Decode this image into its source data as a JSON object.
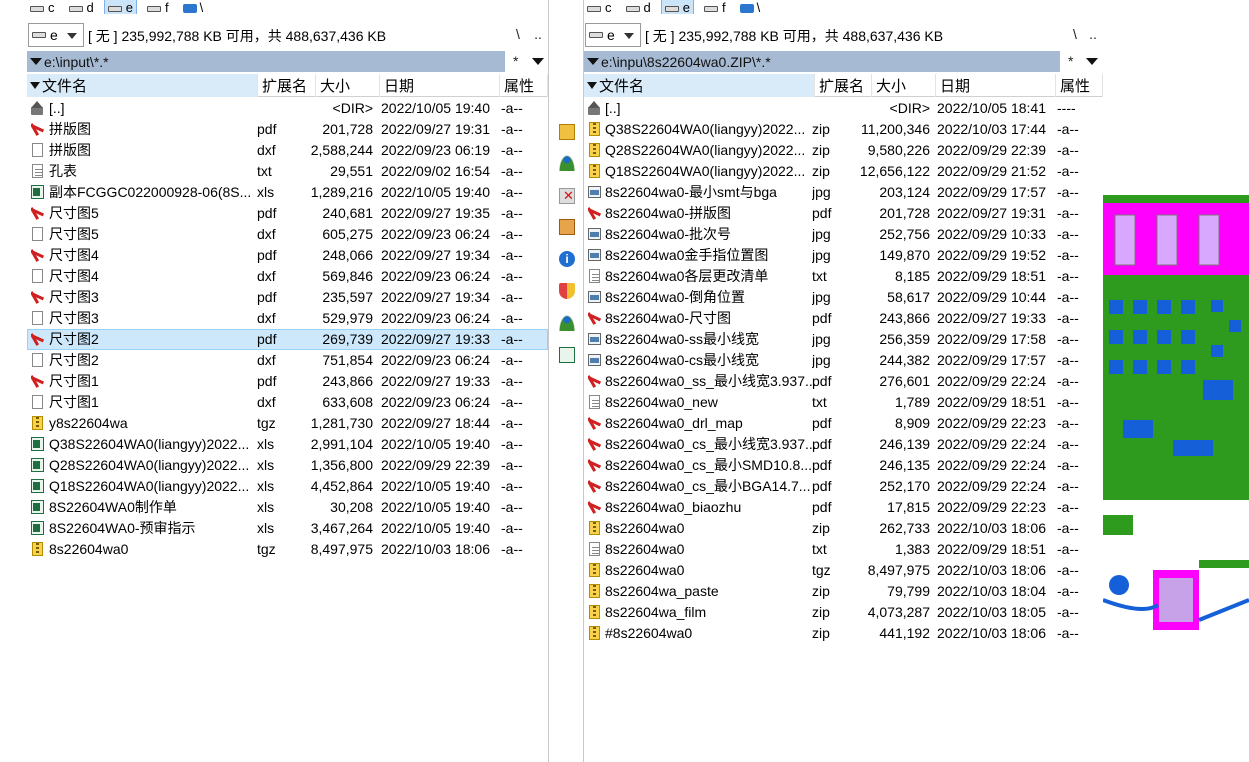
{
  "left": {
    "drives": [
      {
        "label": "c",
        "selected": false,
        "icon": "hard-drive-icon"
      },
      {
        "label": "d",
        "selected": false,
        "icon": "hard-drive-icon"
      },
      {
        "label": "e",
        "selected": true,
        "icon": "hard-drive-icon"
      },
      {
        "label": "f",
        "selected": false,
        "icon": "hard-drive-icon"
      },
      {
        "label": "\\",
        "selected": false,
        "icon": "network-drive-icon"
      }
    ],
    "drive_combo": "e",
    "free_info": "[ 无 ]  235,992,788 KB 可用，共 488,637,436 KB",
    "root_btn": "\\",
    "up_btn": "..",
    "path": "e:\\input\\*.*",
    "fav_btn": "*",
    "columns": {
      "name": "文件名",
      "ext": "扩展名",
      "size": "大小",
      "date": "日期",
      "attr": "属性"
    },
    "files": [
      {
        "icon": "up-folder-icon",
        "name": "[..]",
        "ext": "",
        "size": "<DIR>",
        "date": "2022/10/05 19:40",
        "attr": "-a--"
      },
      {
        "icon": "pdf-icon",
        "name": "拼版图",
        "ext": "pdf",
        "size": "201,728",
        "date": "2022/09/27 19:31",
        "attr": "-a--"
      },
      {
        "icon": "file-icon",
        "name": "拼版图",
        "ext": "dxf",
        "size": "2,588,244",
        "date": "2022/09/23 06:19",
        "attr": "-a--"
      },
      {
        "icon": "text-file-icon",
        "name": "孔表",
        "ext": "txt",
        "size": "29,551",
        "date": "2022/09/02 16:54",
        "attr": "-a--"
      },
      {
        "icon": "excel-icon",
        "name": "副本FCGGC022000928-06(8S...",
        "ext": "xls",
        "size": "1,289,216",
        "date": "2022/10/05 19:40",
        "attr": "-a--"
      },
      {
        "icon": "pdf-icon",
        "name": "尺寸图5",
        "ext": "pdf",
        "size": "240,681",
        "date": "2022/09/27 19:35",
        "attr": "-a--"
      },
      {
        "icon": "file-icon",
        "name": "尺寸图5",
        "ext": "dxf",
        "size": "605,275",
        "date": "2022/09/23 06:24",
        "attr": "-a--"
      },
      {
        "icon": "pdf-icon",
        "name": "尺寸图4",
        "ext": "pdf",
        "size": "248,066",
        "date": "2022/09/27 19:34",
        "attr": "-a--"
      },
      {
        "icon": "file-icon",
        "name": "尺寸图4",
        "ext": "dxf",
        "size": "569,846",
        "date": "2022/09/23 06:24",
        "attr": "-a--"
      },
      {
        "icon": "pdf-icon",
        "name": "尺寸图3",
        "ext": "pdf",
        "size": "235,597",
        "date": "2022/09/27 19:34",
        "attr": "-a--"
      },
      {
        "icon": "file-icon",
        "name": "尺寸图3",
        "ext": "dxf",
        "size": "529,979",
        "date": "2022/09/23 06:24",
        "attr": "-a--"
      },
      {
        "icon": "pdf-icon",
        "name": "尺寸图2",
        "ext": "pdf",
        "size": "269,739",
        "date": "2022/09/27 19:33",
        "attr": "-a--",
        "selected": true
      },
      {
        "icon": "file-icon",
        "name": "尺寸图2",
        "ext": "dxf",
        "size": "751,854",
        "date": "2022/09/23 06:24",
        "attr": "-a--"
      },
      {
        "icon": "pdf-icon",
        "name": "尺寸图1",
        "ext": "pdf",
        "size": "243,866",
        "date": "2022/09/27 19:33",
        "attr": "-a--"
      },
      {
        "icon": "file-icon",
        "name": "尺寸图1",
        "ext": "dxf",
        "size": "633,608",
        "date": "2022/09/23 06:24",
        "attr": "-a--"
      },
      {
        "icon": "archive-icon",
        "name": "y8s22604wa",
        "ext": "tgz",
        "size": "1,281,730",
        "date": "2022/09/27 18:44",
        "attr": "-a--"
      },
      {
        "icon": "excel-icon",
        "name": "Q38S22604WA0(liangyy)2022...",
        "ext": "xls",
        "size": "2,991,104",
        "date": "2022/10/05 19:40",
        "attr": "-a--"
      },
      {
        "icon": "excel-icon",
        "name": "Q28S22604WA0(liangyy)2022...",
        "ext": "xls",
        "size": "1,356,800",
        "date": "2022/09/29 22:39",
        "attr": "-a--"
      },
      {
        "icon": "excel-icon",
        "name": "Q18S22604WA0(liangyy)2022...",
        "ext": "xls",
        "size": "4,452,864",
        "date": "2022/10/05 19:40",
        "attr": "-a--"
      },
      {
        "icon": "excel-icon",
        "name": "8S22604WA0制作单",
        "ext": "xls",
        "size": "30,208",
        "date": "2022/10/05 19:40",
        "attr": "-a--"
      },
      {
        "icon": "excel-icon",
        "name": "8S22604WA0-预审指示",
        "ext": "xls",
        "size": "3,467,264",
        "date": "2022/10/05 19:40",
        "attr": "-a--"
      },
      {
        "icon": "archive-icon",
        "name": "8s22604wa0",
        "ext": "tgz",
        "size": "8,497,975",
        "date": "2022/10/03 18:06",
        "attr": "-a--"
      }
    ]
  },
  "right": {
    "drives": [
      {
        "label": "c",
        "selected": false,
        "icon": "hard-drive-icon"
      },
      {
        "label": "d",
        "selected": false,
        "icon": "hard-drive-icon"
      },
      {
        "label": "e",
        "selected": true,
        "icon": "hard-drive-icon"
      },
      {
        "label": "f",
        "selected": false,
        "icon": "hard-drive-icon"
      },
      {
        "label": "\\",
        "selected": false,
        "icon": "network-drive-icon"
      }
    ],
    "drive_combo": "e",
    "free_info": "[ 无 ]  235,992,788 KB 可用，共 488,637,436 KB",
    "root_btn": "\\",
    "up_btn": "..",
    "path": "e:\\inpu\\8s22604wa0.ZIP\\*.*",
    "fav_btn": "*",
    "columns": {
      "name": "文件名",
      "ext": "扩展名",
      "size": "大小",
      "date": "日期",
      "attr": "属性"
    },
    "files": [
      {
        "icon": "up-folder-icon",
        "name": "[..]",
        "ext": "",
        "size": "<DIR>",
        "date": "2022/10/05 18:41",
        "attr": "----"
      },
      {
        "icon": "archive-icon",
        "name": "Q38S22604WA0(liangyy)2022...",
        "ext": "zip",
        "size": "11,200,346",
        "date": "2022/10/03 17:44",
        "attr": "-a--"
      },
      {
        "icon": "archive-icon",
        "name": "Q28S22604WA0(liangyy)2022...",
        "ext": "zip",
        "size": "9,580,226",
        "date": "2022/09/29 22:39",
        "attr": "-a--"
      },
      {
        "icon": "archive-icon",
        "name": "Q18S22604WA0(liangyy)2022...",
        "ext": "zip",
        "size": "12,656,122",
        "date": "2022/09/29 21:52",
        "attr": "-a--"
      },
      {
        "icon": "image-icon",
        "name": "8s22604wa0-最小smt与bga",
        "ext": "jpg",
        "size": "203,124",
        "date": "2022/09/29 17:57",
        "attr": "-a--"
      },
      {
        "icon": "pdf-icon",
        "name": "8s22604wa0-拼版图",
        "ext": "pdf",
        "size": "201,728",
        "date": "2022/09/27 19:31",
        "attr": "-a--"
      },
      {
        "icon": "image-icon",
        "name": "8s22604wa0-批次号",
        "ext": "jpg",
        "size": "252,756",
        "date": "2022/09/29 10:33",
        "attr": "-a--"
      },
      {
        "icon": "image-icon",
        "name": "8s22604wa0金手指位置图",
        "ext": "jpg",
        "size": "149,870",
        "date": "2022/09/29 19:52",
        "attr": "-a--"
      },
      {
        "icon": "text-file-icon",
        "name": "8s22604wa0各层更改清单",
        "ext": "txt",
        "size": "8,185",
        "date": "2022/09/29 18:51",
        "attr": "-a--"
      },
      {
        "icon": "image-icon",
        "name": "8s22604wa0-倒角位置",
        "ext": "jpg",
        "size": "58,617",
        "date": "2022/09/29 10:44",
        "attr": "-a--"
      },
      {
        "icon": "pdf-icon",
        "name": "8s22604wa0-尺寸图",
        "ext": "pdf",
        "size": "243,866",
        "date": "2022/09/27 19:33",
        "attr": "-a--"
      },
      {
        "icon": "image-icon",
        "name": "8s22604wa0-ss最小线宽",
        "ext": "jpg",
        "size": "256,359",
        "date": "2022/09/29 17:58",
        "attr": "-a--"
      },
      {
        "icon": "image-icon",
        "name": "8s22604wa0-cs最小线宽",
        "ext": "jpg",
        "size": "244,382",
        "date": "2022/09/29 17:57",
        "attr": "-a--"
      },
      {
        "icon": "pdf-icon",
        "name": "8s22604wa0_ss_最小线宽3.937...",
        "ext": "pdf",
        "size": "276,601",
        "date": "2022/09/29 22:24",
        "attr": "-a--"
      },
      {
        "icon": "text-file-icon",
        "name": "8s22604wa0_new",
        "ext": "txt",
        "size": "1,789",
        "date": "2022/09/29 18:51",
        "attr": "-a--"
      },
      {
        "icon": "pdf-icon",
        "name": "8s22604wa0_drl_map",
        "ext": "pdf",
        "size": "8,909",
        "date": "2022/09/29 22:23",
        "attr": "-a--"
      },
      {
        "icon": "pdf-icon",
        "name": "8s22604wa0_cs_最小线宽3.937...",
        "ext": "pdf",
        "size": "246,139",
        "date": "2022/09/29 22:24",
        "attr": "-a--"
      },
      {
        "icon": "pdf-icon",
        "name": "8s22604wa0_cs_最小SMD10.8...",
        "ext": "pdf",
        "size": "246,135",
        "date": "2022/09/29 22:24",
        "attr": "-a--"
      },
      {
        "icon": "pdf-icon",
        "name": "8s22604wa0_cs_最小BGA14.7...",
        "ext": "pdf",
        "size": "252,170",
        "date": "2022/09/29 22:24",
        "attr": "-a--"
      },
      {
        "icon": "pdf-icon",
        "name": "8s22604wa0_biaozhu",
        "ext": "pdf",
        "size": "17,815",
        "date": "2022/09/29 22:23",
        "attr": "-a--"
      },
      {
        "icon": "archive-icon",
        "name": "8s22604wa0",
        "ext": "zip",
        "size": "262,733",
        "date": "2022/10/03 18:06",
        "attr": "-a--"
      },
      {
        "icon": "text-file-icon",
        "name": "8s22604wa0",
        "ext": "txt",
        "size": "1,383",
        "date": "2022/09/29 18:51",
        "attr": "-a--"
      },
      {
        "icon": "archive-icon",
        "name": "8s22604wa0",
        "ext": "tgz",
        "size": "8,497,975",
        "date": "2022/10/03 18:06",
        "attr": "-a--"
      },
      {
        "icon": "archive-icon",
        "name": "8s22604wa_paste",
        "ext": "zip",
        "size": "79,799",
        "date": "2022/10/03 18:04",
        "attr": "-a--"
      },
      {
        "icon": "archive-icon",
        "name": "8s22604wa_film",
        "ext": "zip",
        "size": "4,073,287",
        "date": "2022/10/03 18:05",
        "attr": "-a--"
      },
      {
        "icon": "archive-icon",
        "name": "#8s22604wa0",
        "ext": "zip",
        "size": "441,192",
        "date": "2022/10/03 18:06",
        "attr": "-a--"
      }
    ]
  },
  "toolbar": [
    {
      "name": "mail-icon",
      "tip": ""
    },
    {
      "name": "users-icon",
      "tip": ""
    },
    {
      "name": "delete-icon",
      "tip": ""
    },
    {
      "name": "photo-icon",
      "tip": ""
    },
    {
      "name": "info-icon",
      "tip": ""
    },
    {
      "name": "shield-icon",
      "tip": ""
    },
    {
      "name": "users-icon",
      "tip": ""
    },
    {
      "name": "excel-icon",
      "tip": ""
    }
  ],
  "colors": {
    "path_bar": "#a6bbd3",
    "selected_row": "#cde8fb",
    "cam_magenta": "#ff00ff",
    "cam_green": "#2e9a1e",
    "cam_blue": "#1560d8"
  }
}
